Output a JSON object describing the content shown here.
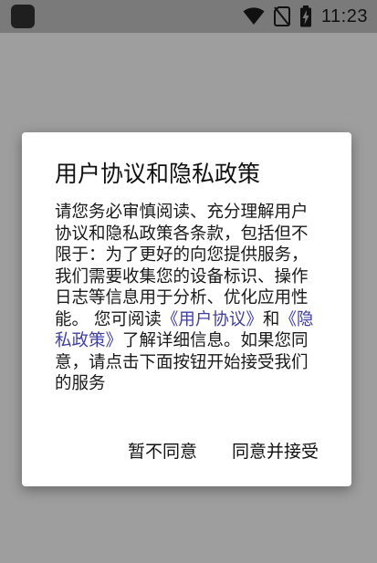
{
  "status_bar": {
    "time": "11:23",
    "icons": [
      "notification-icon",
      "wifi-icon",
      "no-sim-icon",
      "battery-charging-icon"
    ]
  },
  "dialog": {
    "title": "用户协议和隐私政策",
    "body_prefix": "请您务必审慎阅读、充分理解用户协议和隐私政策各条款，包括但不限于：为了更好的向您提供服务，我们需要收集您的设备标识、操作日志等信息用于分析、优化应用性能。 您可阅读",
    "user_agreement_link": "《用户协议》",
    "and_text": "和",
    "privacy_policy_link": "《隐私政策》",
    "body_suffix": "了解详细信息。如果您同意，请点击下面按钮开始接受我们的服务",
    "disagree_label": "暂不同意",
    "agree_label": "同意并接受"
  },
  "colors": {
    "scrim": "#9e9e9e",
    "status_bar": "#7a7a7a",
    "dialog_bg": "#ffffff",
    "link": "#3f3fa8"
  }
}
